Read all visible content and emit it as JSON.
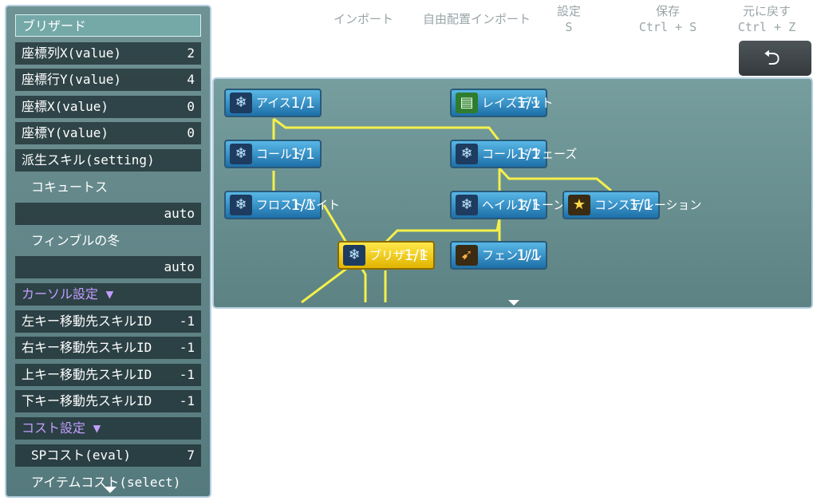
{
  "sidebar": {
    "title": "ブリザード",
    "props": [
      {
        "label": "座標列X(value)",
        "value": "2"
      },
      {
        "label": "座標行Y(value)",
        "value": "4"
      },
      {
        "label": "座標X(value)",
        "value": "0"
      },
      {
        "label": "座標Y(value)",
        "value": "0"
      }
    ],
    "derived_label": "派生スキル(setting)",
    "derived": [
      {
        "name": "コキュートス",
        "value": "auto"
      },
      {
        "name": "フィンブルの冬",
        "value": "auto"
      }
    ],
    "cursor_section": "カーソル設定 ▼",
    "cursor_props": [
      {
        "label": "左キー移動先スキルID",
        "value": "-1"
      },
      {
        "label": "右キー移動先スキルID",
        "value": "-1"
      },
      {
        "label": "上キー移動先スキルID",
        "value": "-1"
      },
      {
        "label": "下キー移動先スキルID",
        "value": "-1"
      }
    ],
    "cost_section": "コスト設定 ▼",
    "sp_cost": {
      "label": "SPコスト(eval)",
      "value": "7"
    },
    "item_cost": {
      "label": "アイテムコスト(select)"
    }
  },
  "menu": {
    "import": "インポート",
    "auto_import": "自由配置インポート",
    "settings": {
      "label": "設定",
      "shortcut": "S"
    },
    "save": {
      "label": "保存",
      "shortcut": "Ctrl + S"
    },
    "undo": {
      "label": "元に戻す",
      "shortcut": "Ctrl + Z"
    },
    "back_icon": "return-arrow-icon"
  },
  "tree": {
    "nodes": [
      {
        "id": "ice",
        "name": "アイス",
        "level": "1/1",
        "icon": "snowflake-icon"
      },
      {
        "id": "cold",
        "name": "コールド",
        "level": "1/1",
        "icon": "snowflake-icon"
      },
      {
        "id": "frostbite",
        "name": "フロストバイト",
        "level": "1/1",
        "icon": "snowflake-icon"
      },
      {
        "id": "blizzard",
        "name": "ブリザード",
        "level": "1/1",
        "icon": "snowflake-icon",
        "selected": true
      },
      {
        "id": "resist",
        "name": "レイズデット",
        "level": "1/1",
        "icon": "book-icon"
      },
      {
        "id": "coldfaze",
        "name": "コールドフェーズ",
        "level": "1/1",
        "icon": "snowflake-icon"
      },
      {
        "id": "hailstone",
        "name": "ヘイルストーン",
        "level": "1/1",
        "icon": "snowflake-icon"
      },
      {
        "id": "constellation",
        "name": "コンステレーション",
        "level": "1/1",
        "icon": "star-icon"
      },
      {
        "id": "fenrir",
        "name": "フェンリル",
        "level": "1/1",
        "icon": "runner-icon"
      }
    ]
  },
  "colors": {
    "panel": "#5f8586",
    "link_line": "#f3f04a",
    "node_blue": "#2f8cc8",
    "node_selected": "#f2cf1a",
    "section_text": "#c39dff"
  }
}
